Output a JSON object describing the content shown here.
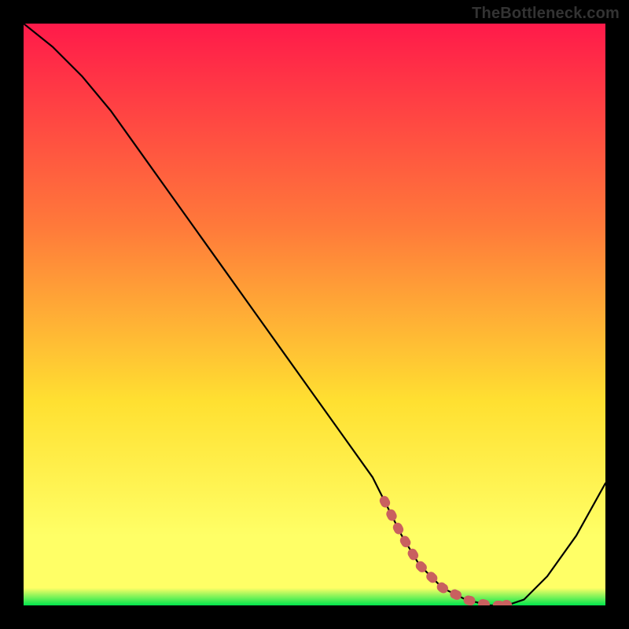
{
  "watermark": "TheBottleneck.com",
  "chart_data": {
    "type": "line",
    "title": "",
    "xlabel": "",
    "ylabel": "",
    "xlim": [
      0,
      100
    ],
    "ylim": [
      0,
      100
    ],
    "grid": false,
    "series": [
      {
        "name": "curve",
        "x": [
          0,
          5,
          10,
          15,
          20,
          25,
          30,
          35,
          40,
          45,
          50,
          55,
          60,
          62,
          65,
          68,
          72,
          76,
          80,
          83,
          86,
          90,
          95,
          100
        ],
        "values": [
          100,
          96,
          91,
          85,
          78,
          71,
          64,
          57,
          50,
          43,
          36,
          29,
          22,
          18,
          12,
          7,
          3,
          1,
          0,
          0,
          1,
          5,
          12,
          21
        ]
      }
    ],
    "highlight_range_x": [
      62,
      84
    ],
    "background_gradient": {
      "top": "#ff1a4a",
      "mid1": "#ff7a3a",
      "mid2": "#ffe031",
      "low": "#ffff66",
      "bottom": "#00e64d"
    },
    "curve_color": "#000000",
    "highlight_color": "#c9605f"
  }
}
